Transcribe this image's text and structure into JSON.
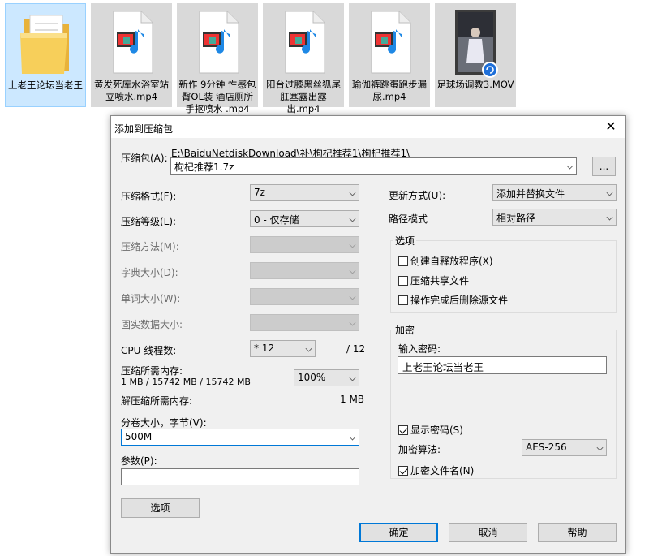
{
  "files": [
    {
      "name": "上老王论坛当老王",
      "type": "folder",
      "icon": "folder-icon"
    },
    {
      "name": "黄发死库水浴室站立喷水.mp4",
      "type": "video",
      "icon": "video-file-icon"
    },
    {
      "name": "新作 9分钟 性感包臀OL装 酒店厕所手抠喷水 .mp4",
      "type": "video",
      "icon": "video-file-icon"
    },
    {
      "name": "阳台过膝黑丝狐尾肛塞露出露出.mp4",
      "type": "video",
      "icon": "video-file-icon"
    },
    {
      "name": "瑜伽裤跳蛋跑步漏尿.mp4",
      "type": "video",
      "icon": "video-file-icon"
    },
    {
      "name": "足球场调教3.MOV",
      "type": "video",
      "icon": "video-thumbnail-icon"
    }
  ],
  "dialog": {
    "title": "添加到压缩包",
    "close_label": "✕",
    "archive_label": "压缩包(A):",
    "archive_path": "E:\\BaiduNetdiskDownload\\补\\枸杞推荐1\\枸杞推荐1\\",
    "archive_name": "枸杞推荐1.7z",
    "browse_label": "...",
    "format_label": "压缩格式(F):",
    "format_value": "7z",
    "level_label": "压缩等级(L):",
    "level_value": "0 - 仅存储",
    "method_label": "压缩方法(M):",
    "dict_label": "字典大小(D):",
    "word_label": "单词大小(W):",
    "solid_label": "固实数据大小:",
    "cpu_label": "CPU 线程数:",
    "cpu_value": "* 12",
    "cpu_max": "/ 12",
    "mem_label": "压缩所需内存:",
    "mem_value": "1 MB / 15742 MB / 15742 MB",
    "mem_percent": "100%",
    "decomp_label": "解压缩所需内存:",
    "decomp_value": "1 MB",
    "volume_label": "分卷大小，字节(V):",
    "volume_value": "500M",
    "params_label": "参数(P):",
    "params_value": "",
    "options_button": "选项",
    "update_label": "更新方式(U):",
    "update_value": "添加并替换文件",
    "path_label": "路径模式",
    "path_value": "相对路径",
    "options_group": "选项",
    "opt_sfx": "创建自释放程序(X)",
    "opt_shared": "压缩共享文件",
    "opt_delete": "操作完成后删除源文件",
    "opt_sfx_checked": false,
    "opt_shared_checked": false,
    "opt_delete_checked": false,
    "encrypt_group": "加密",
    "password_label": "输入密码:",
    "password_value": "上老王论坛当老王",
    "show_password": "显示密码(S)",
    "show_password_checked": true,
    "enc_method_label": "加密算法:",
    "enc_method_value": "AES-256",
    "encrypt_names": "加密文件名(N)",
    "encrypt_names_checked": true,
    "ok_button": "确定",
    "cancel_button": "取消",
    "help_button": "帮助"
  },
  "colors": {
    "selected_tile": "#cce8ff",
    "dialog_bg": "#f0f0f0",
    "focus_blue": "#0078d7",
    "folder_yellow": "#f5c542"
  }
}
